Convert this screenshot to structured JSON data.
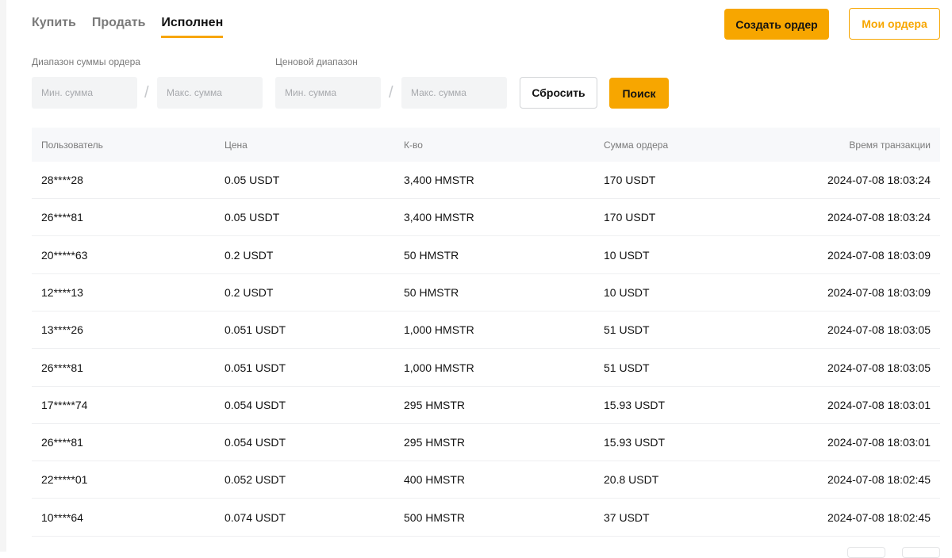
{
  "tabs": [
    {
      "label": "Купить"
    },
    {
      "label": "Продать"
    },
    {
      "label": "Исполнен"
    }
  ],
  "header": {
    "create_order_label": "Создать ордер",
    "my_orders_label": "Мои ордера"
  },
  "filters": {
    "amount_range_label": "Диапазон суммы ордера",
    "price_range_label": "Ценовой диапазон",
    "min_amount_placeholder": "Мин. сумма",
    "max_amount_placeholder": "Макс. сумма",
    "min_price_placeholder": "Мин. сумма",
    "max_price_placeholder": "Макс. сумма",
    "separator": "/",
    "reset_label": "Сбросить",
    "search_label": "Поиск"
  },
  "table": {
    "columns": [
      "Пользователь",
      "Цена",
      "К-во",
      "Сумма ордера",
      "Время транзакции"
    ],
    "rows": [
      {
        "user": "28****28",
        "price": "0.05 USDT",
        "qty": "3,400 HMSTR",
        "sum": "170 USDT",
        "time": "2024-07-08 18:03:24"
      },
      {
        "user": "26****81",
        "price": "0.05 USDT",
        "qty": "3,400 HMSTR",
        "sum": "170 USDT",
        "time": "2024-07-08 18:03:24"
      },
      {
        "user": "20*****63",
        "price": "0.2 USDT",
        "qty": "50 HMSTR",
        "sum": "10 USDT",
        "time": "2024-07-08 18:03:09"
      },
      {
        "user": "12****13",
        "price": "0.2 USDT",
        "qty": "50 HMSTR",
        "sum": "10 USDT",
        "time": "2024-07-08 18:03:09"
      },
      {
        "user": "13****26",
        "price": "0.051 USDT",
        "qty": "1,000 HMSTR",
        "sum": "51 USDT",
        "time": "2024-07-08 18:03:05"
      },
      {
        "user": "26****81",
        "price": "0.051 USDT",
        "qty": "1,000 HMSTR",
        "sum": "51 USDT",
        "time": "2024-07-08 18:03:05"
      },
      {
        "user": "17*****74",
        "price": "0.054 USDT",
        "qty": "295 HMSTR",
        "sum": "15.93 USDT",
        "time": "2024-07-08 18:03:01"
      },
      {
        "user": "26****81",
        "price": "0.054 USDT",
        "qty": "295 HMSTR",
        "sum": "15.93 USDT",
        "time": "2024-07-08 18:03:01"
      },
      {
        "user": "22*****01",
        "price": "0.052 USDT",
        "qty": "400 HMSTR",
        "sum": "20.8 USDT",
        "time": "2024-07-08 18:02:45"
      },
      {
        "user": "10****64",
        "price": "0.074 USDT",
        "qty": "500 HMSTR",
        "sum": "37 USDT",
        "time": "2024-07-08 18:02:45"
      }
    ]
  },
  "colors": {
    "accent": "#f7a600",
    "text_primary": "#121212",
    "text_secondary": "#7a7a7a",
    "input_bg": "#f3f4f5"
  }
}
